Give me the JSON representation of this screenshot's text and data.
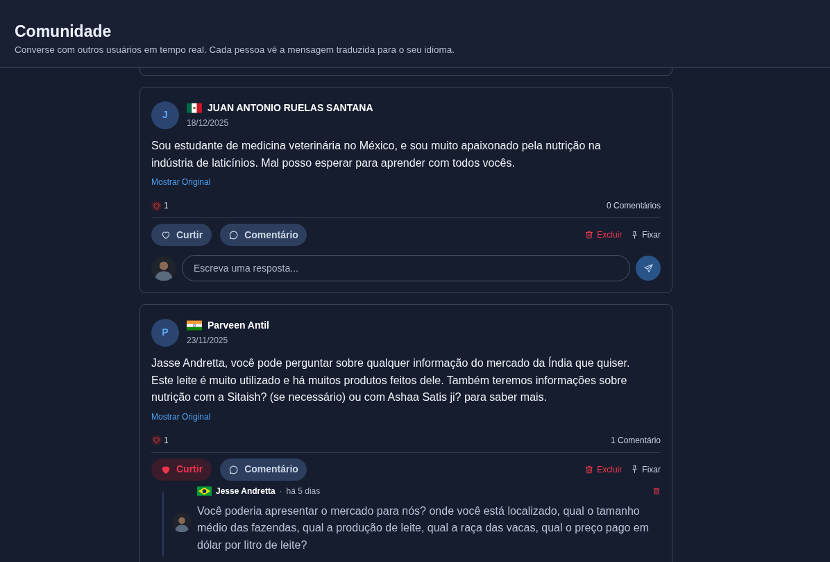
{
  "header": {
    "title": "Comunidade",
    "subtitle": "Converse com outros usuários em tempo real. Cada pessoa vê a mensagem traduzida para o seu idioma."
  },
  "posts": [
    {
      "initial": "J",
      "flag": {
        "kind": "mexico"
      },
      "author": "JUAN ANTONIO RUELAS SANTANA",
      "date": "18/12/2025",
      "body": "Sou estudante de medicina veterinária no México, e sou muito apaixonado pela nutrição na indústria de laticínios. Mal posso esperar para aprender com todos vocês.",
      "show_original": "Mostrar Original",
      "likes": "1",
      "comments_count": "0 Comentários",
      "liked": false,
      "like_label": "Curtir",
      "comment_label": "Comentário",
      "delete_label": "Excluir",
      "pin_label": "Fixar",
      "reply_placeholder": "Escreva uma resposta..."
    },
    {
      "initial": "P",
      "flag": {
        "kind": "india"
      },
      "author": "Parveen Antil",
      "date": "23/11/2025",
      "body": "Jasse Andretta, você pode perguntar sobre qualquer informação do mercado da Índia que quiser. Este leite é muito utilizado e há muitos produtos feitos dele. Também teremos informações sobre nutrição com a Sitaish? (se necessário) ou com Ashaa Satis ji? para saber mais.",
      "show_original": "Mostrar Original",
      "likes": "1",
      "comments_count": "1 Comentário",
      "liked": true,
      "like_label": "Curtir",
      "comment_label": "Comentário",
      "delete_label": "Excluir",
      "pin_label": "Fixar",
      "comments": [
        {
          "flag": {
            "kind": "brazil"
          },
          "author": "Jesse Andretta",
          "separator": "·",
          "time": "há 5 dias",
          "text": "Você poderia apresentar o mercado para nós? onde você está localizado, qual o tamanho médio das fazendas, qual a produção de leite, qual a raça das vacas, qual o preço pago em dólar por litro de leite?"
        }
      ]
    }
  ]
}
